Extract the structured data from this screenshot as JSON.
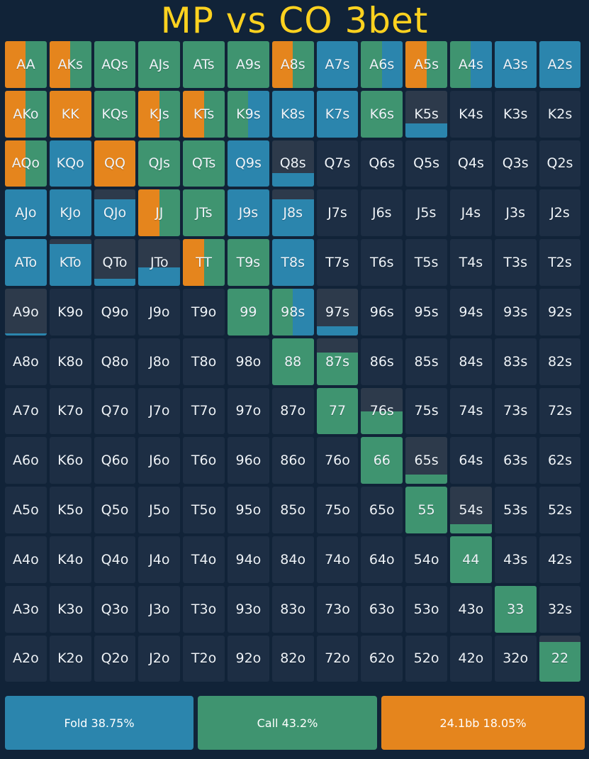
{
  "title": "MP vs CO 3bet",
  "colors": {
    "fold": "#2b85ad",
    "call": "#3f9470",
    "raise": "#e5851d",
    "empty": "#1d2e44",
    "background": "#112338"
  },
  "chart_data": {
    "type": "heatmap",
    "title": "MP vs CO 3bet",
    "ranks": [
      "A",
      "K",
      "Q",
      "J",
      "T",
      "9",
      "8",
      "7",
      "6",
      "5",
      "4",
      "3",
      "2"
    ],
    "actions": [
      "raise",
      "call",
      "fold"
    ],
    "cells": [
      [
        "AA",
        0.5,
        0.5,
        0
      ],
      [
        "AKs",
        0.5,
        0.5,
        0
      ],
      [
        "AQs",
        0,
        1,
        0
      ],
      [
        "AJs",
        0,
        1,
        0
      ],
      [
        "ATs",
        0,
        1,
        0
      ],
      [
        "A9s",
        0,
        1,
        0
      ],
      [
        "A8s",
        0.5,
        0.5,
        0
      ],
      [
        "A7s",
        0,
        0,
        1
      ],
      [
        "A6s",
        0,
        0.5,
        0.5
      ],
      [
        "A5s",
        0.5,
        0.5,
        0
      ],
      [
        "A4s",
        0,
        0.5,
        0.5
      ],
      [
        "A3s",
        0,
        0,
        1
      ],
      [
        "A2s",
        0,
        0,
        1
      ],
      [
        "AKo",
        0.5,
        0.5,
        0
      ],
      [
        "KK",
        1,
        0,
        0
      ],
      [
        "KQs",
        0,
        1,
        0
      ],
      [
        "KJs",
        0.5,
        0.5,
        0
      ],
      [
        "KTs",
        0.5,
        0.5,
        0
      ],
      [
        "K9s",
        0,
        0.5,
        0.5
      ],
      [
        "K8s",
        0,
        0,
        1
      ],
      [
        "K7s",
        0,
        0,
        1
      ],
      [
        "K6s",
        0,
        1,
        0
      ],
      [
        "K5s",
        0,
        0,
        0.3
      ],
      [
        "K4s",
        0,
        0,
        0
      ],
      [
        "K3s",
        0,
        0,
        0
      ],
      [
        "K2s",
        0,
        0,
        0
      ],
      [
        "AQo",
        0.5,
        0.5,
        0
      ],
      [
        "KQo",
        0,
        0,
        1
      ],
      [
        "QQ",
        1,
        0,
        0
      ],
      [
        "QJs",
        0,
        1,
        0
      ],
      [
        "QTs",
        0,
        1,
        0
      ],
      [
        "Q9s",
        0,
        0,
        1
      ],
      [
        "Q8s",
        0,
        0,
        0.3
      ],
      [
        "Q7s",
        0,
        0,
        0
      ],
      [
        "Q6s",
        0,
        0,
        0
      ],
      [
        "Q5s",
        0,
        0,
        0
      ],
      [
        "Q4s",
        0,
        0,
        0
      ],
      [
        "Q3s",
        0,
        0,
        0
      ],
      [
        "Q2s",
        0,
        0,
        0
      ],
      [
        "AJo",
        0,
        0,
        1
      ],
      [
        "KJo",
        0,
        0,
        1
      ],
      [
        "QJo",
        0,
        0,
        0.8
      ],
      [
        "JJ",
        0.5,
        0.5,
        0
      ],
      [
        "JTs",
        0,
        1,
        0
      ],
      [
        "J9s",
        0,
        0,
        1
      ],
      [
        "J8s",
        0,
        0,
        0.8
      ],
      [
        "J7s",
        0,
        0,
        0
      ],
      [
        "J6s",
        0,
        0,
        0
      ],
      [
        "J5s",
        0,
        0,
        0
      ],
      [
        "J4s",
        0,
        0,
        0
      ],
      [
        "J3s",
        0,
        0,
        0
      ],
      [
        "J2s",
        0,
        0,
        0
      ],
      [
        "ATo",
        0,
        0,
        1
      ],
      [
        "KTo",
        0,
        0,
        0.9
      ],
      [
        "QTo",
        0,
        0,
        0.15
      ],
      [
        "JTo",
        0,
        0,
        0.4
      ],
      [
        "TT",
        0.5,
        0.5,
        0
      ],
      [
        "T9s",
        0,
        1,
        0
      ],
      [
        "T8s",
        0,
        0,
        1
      ],
      [
        "T7s",
        0,
        0,
        0
      ],
      [
        "T6s",
        0,
        0,
        0
      ],
      [
        "T5s",
        0,
        0,
        0
      ],
      [
        "T4s",
        0,
        0,
        0
      ],
      [
        "T3s",
        0,
        0,
        0
      ],
      [
        "T2s",
        0,
        0,
        0
      ],
      [
        "A9o",
        0,
        0,
        0.05
      ],
      [
        "K9o",
        0,
        0,
        0
      ],
      [
        "Q9o",
        0,
        0,
        0
      ],
      [
        "J9o",
        0,
        0,
        0
      ],
      [
        "T9o",
        0,
        0,
        0
      ],
      [
        "99",
        0,
        1,
        0
      ],
      [
        "98s",
        0,
        0.5,
        0.5
      ],
      [
        "97s",
        0,
        0,
        0.2
      ],
      [
        "96s",
        0,
        0,
        0
      ],
      [
        "95s",
        0,
        0,
        0
      ],
      [
        "94s",
        0,
        0,
        0
      ],
      [
        "93s",
        0,
        0,
        0
      ],
      [
        "92s",
        0,
        0,
        0
      ],
      [
        "A8o",
        0,
        0,
        0
      ],
      [
        "K8o",
        0,
        0,
        0
      ],
      [
        "Q8o",
        0,
        0,
        0
      ],
      [
        "J8o",
        0,
        0,
        0
      ],
      [
        "T8o",
        0,
        0,
        0
      ],
      [
        "98o",
        0,
        0,
        0
      ],
      [
        "88",
        0,
        1,
        0
      ],
      [
        "87s",
        0,
        0.7,
        0
      ],
      [
        "86s",
        0,
        0,
        0
      ],
      [
        "85s",
        0,
        0,
        0
      ],
      [
        "84s",
        0,
        0,
        0
      ],
      [
        "83s",
        0,
        0,
        0
      ],
      [
        "82s",
        0,
        0,
        0
      ],
      [
        "A7o",
        0,
        0,
        0
      ],
      [
        "K7o",
        0,
        0,
        0
      ],
      [
        "Q7o",
        0,
        0,
        0
      ],
      [
        "J7o",
        0,
        0,
        0
      ],
      [
        "T7o",
        0,
        0,
        0
      ],
      [
        "97o",
        0,
        0,
        0
      ],
      [
        "87o",
        0,
        0,
        0
      ],
      [
        "77",
        0,
        1,
        0
      ],
      [
        "76s",
        0,
        0.5,
        0
      ],
      [
        "75s",
        0,
        0,
        0
      ],
      [
        "74s",
        0,
        0,
        0
      ],
      [
        "73s",
        0,
        0,
        0
      ],
      [
        "72s",
        0,
        0,
        0
      ],
      [
        "A6o",
        0,
        0,
        0
      ],
      [
        "K6o",
        0,
        0,
        0
      ],
      [
        "Q6o",
        0,
        0,
        0
      ],
      [
        "J6o",
        0,
        0,
        0
      ],
      [
        "T6o",
        0,
        0,
        0
      ],
      [
        "96o",
        0,
        0,
        0
      ],
      [
        "86o",
        0,
        0,
        0
      ],
      [
        "76o",
        0,
        0,
        0
      ],
      [
        "66",
        0,
        1,
        0
      ],
      [
        "65s",
        0,
        0.2,
        0
      ],
      [
        "64s",
        0,
        0,
        0
      ],
      [
        "63s",
        0,
        0,
        0
      ],
      [
        "62s",
        0,
        0,
        0
      ],
      [
        "A5o",
        0,
        0,
        0
      ],
      [
        "K5o",
        0,
        0,
        0
      ],
      [
        "Q5o",
        0,
        0,
        0
      ],
      [
        "J5o",
        0,
        0,
        0
      ],
      [
        "T5o",
        0,
        0,
        0
      ],
      [
        "95o",
        0,
        0,
        0
      ],
      [
        "85o",
        0,
        0,
        0
      ],
      [
        "75o",
        0,
        0,
        0
      ],
      [
        "65o",
        0,
        0,
        0
      ],
      [
        "55",
        0,
        1,
        0
      ],
      [
        "54s",
        0,
        0.2,
        0
      ],
      [
        "53s",
        0,
        0,
        0
      ],
      [
        "52s",
        0,
        0,
        0
      ],
      [
        "A4o",
        0,
        0,
        0
      ],
      [
        "K4o",
        0,
        0,
        0
      ],
      [
        "Q4o",
        0,
        0,
        0
      ],
      [
        "J4o",
        0,
        0,
        0
      ],
      [
        "T4o",
        0,
        0,
        0
      ],
      [
        "94o",
        0,
        0,
        0
      ],
      [
        "84o",
        0,
        0,
        0
      ],
      [
        "74o",
        0,
        0,
        0
      ],
      [
        "64o",
        0,
        0,
        0
      ],
      [
        "54o",
        0,
        0,
        0
      ],
      [
        "44",
        0,
        1,
        0
      ],
      [
        "43s",
        0,
        0,
        0
      ],
      [
        "42s",
        0,
        0,
        0
      ],
      [
        "A3o",
        0,
        0,
        0
      ],
      [
        "K3o",
        0,
        0,
        0
      ],
      [
        "Q3o",
        0,
        0,
        0
      ],
      [
        "J3o",
        0,
        0,
        0
      ],
      [
        "T3o",
        0,
        0,
        0
      ],
      [
        "93o",
        0,
        0,
        0
      ],
      [
        "83o",
        0,
        0,
        0
      ],
      [
        "73o",
        0,
        0,
        0
      ],
      [
        "63o",
        0,
        0,
        0
      ],
      [
        "53o",
        0,
        0,
        0
      ],
      [
        "43o",
        0,
        0,
        0
      ],
      [
        "33",
        0,
        1,
        0
      ],
      [
        "32s",
        0,
        0,
        0
      ],
      [
        "A2o",
        0,
        0,
        0
      ],
      [
        "K2o",
        0,
        0,
        0
      ],
      [
        "Q2o",
        0,
        0,
        0
      ],
      [
        "J2o",
        0,
        0,
        0
      ],
      [
        "T2o",
        0,
        0,
        0
      ],
      [
        "92o",
        0,
        0,
        0
      ],
      [
        "82o",
        0,
        0,
        0
      ],
      [
        "72o",
        0,
        0,
        0
      ],
      [
        "62o",
        0,
        0,
        0
      ],
      [
        "52o",
        0,
        0,
        0
      ],
      [
        "42o",
        0,
        0,
        0
      ],
      [
        "32o",
        0,
        0,
        0
      ],
      [
        "22",
        0,
        0.85,
        0
      ]
    ],
    "legend": [
      {
        "action": "fold",
        "label": "Fold 38.75%",
        "percent": 38.75
      },
      {
        "action": "call",
        "label": "Call 43.2%",
        "percent": 43.2
      },
      {
        "action": "raise",
        "label": "24.1bb 18.05%",
        "percent": 18.05
      }
    ]
  }
}
